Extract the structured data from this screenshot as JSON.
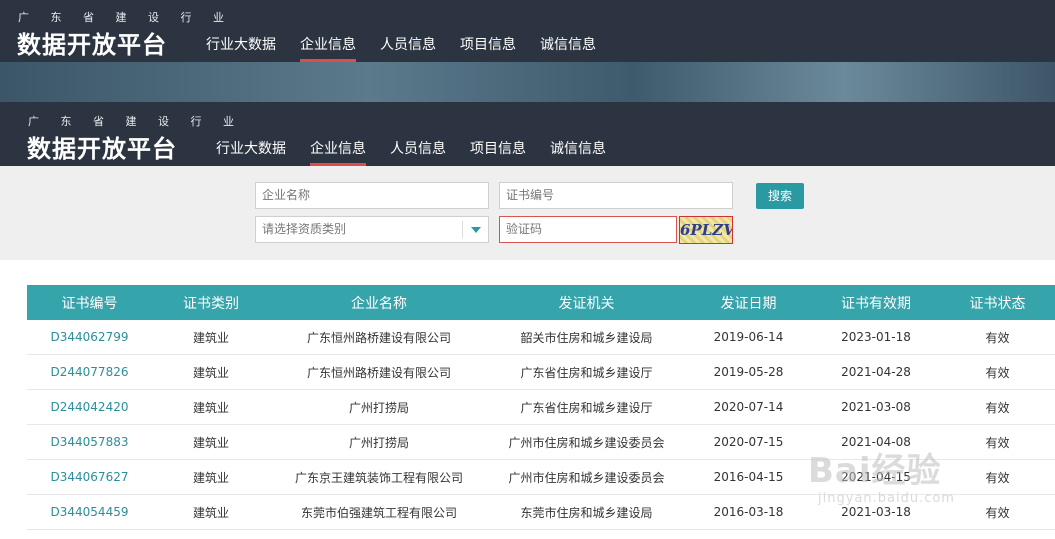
{
  "back_header": {
    "subtitle": "广 东 省 建 设 行 业",
    "title": "数据开放平台",
    "nav": [
      "行业大数据",
      "企业信息",
      "人员信息",
      "项目信息",
      "诚信信息"
    ]
  },
  "header": {
    "subtitle": "广 东 省 建 设 行 业",
    "title": "数据开放平台",
    "nav": [
      "行业大数据",
      "企业信息",
      "人员信息",
      "项目信息",
      "诚信信息"
    ],
    "active_index": 1
  },
  "search": {
    "company_placeholder": "企业名称",
    "cert_no_placeholder": "证书编号",
    "qual_type_placeholder": "请选择资质类别",
    "captcha_placeholder": "验证码",
    "captcha_text": "6PLZV",
    "search_label": "搜索"
  },
  "table": {
    "columns": [
      "证书编号",
      "证书类别",
      "企业名称",
      "发证机关",
      "发证日期",
      "证书有效期",
      "证书状态"
    ],
    "rows": [
      [
        "D344062799",
        "建筑业",
        "广东恒州路桥建设有限公司",
        "韶关市住房和城乡建设局",
        "2019-06-14",
        "2023-01-18",
        "有效"
      ],
      [
        "D244077826",
        "建筑业",
        "广东恒州路桥建设有限公司",
        "广东省住房和城乡建设厅",
        "2019-05-28",
        "2021-04-28",
        "有效"
      ],
      [
        "D244042420",
        "建筑业",
        "广州打捞局",
        "广东省住房和城乡建设厅",
        "2020-07-14",
        "2021-03-08",
        "有效"
      ],
      [
        "D344057883",
        "建筑业",
        "广州打捞局",
        "广州市住房和城乡建设委员会",
        "2020-07-15",
        "2021-04-08",
        "有效"
      ],
      [
        "D344067627",
        "建筑业",
        "广东京王建筑装饰工程有限公司",
        "广州市住房和城乡建设委员会",
        "2016-04-15",
        "2021-04-15",
        "有效"
      ],
      [
        "D344054459",
        "建筑业",
        "东莞市伯强建筑工程有限公司",
        "东莞市住房和城乡建设局",
        "2016-03-18",
        "2021-03-18",
        "有效"
      ]
    ]
  },
  "watermark": {
    "brand": "Bai经验",
    "url": "jingyan.baidu.com"
  }
}
